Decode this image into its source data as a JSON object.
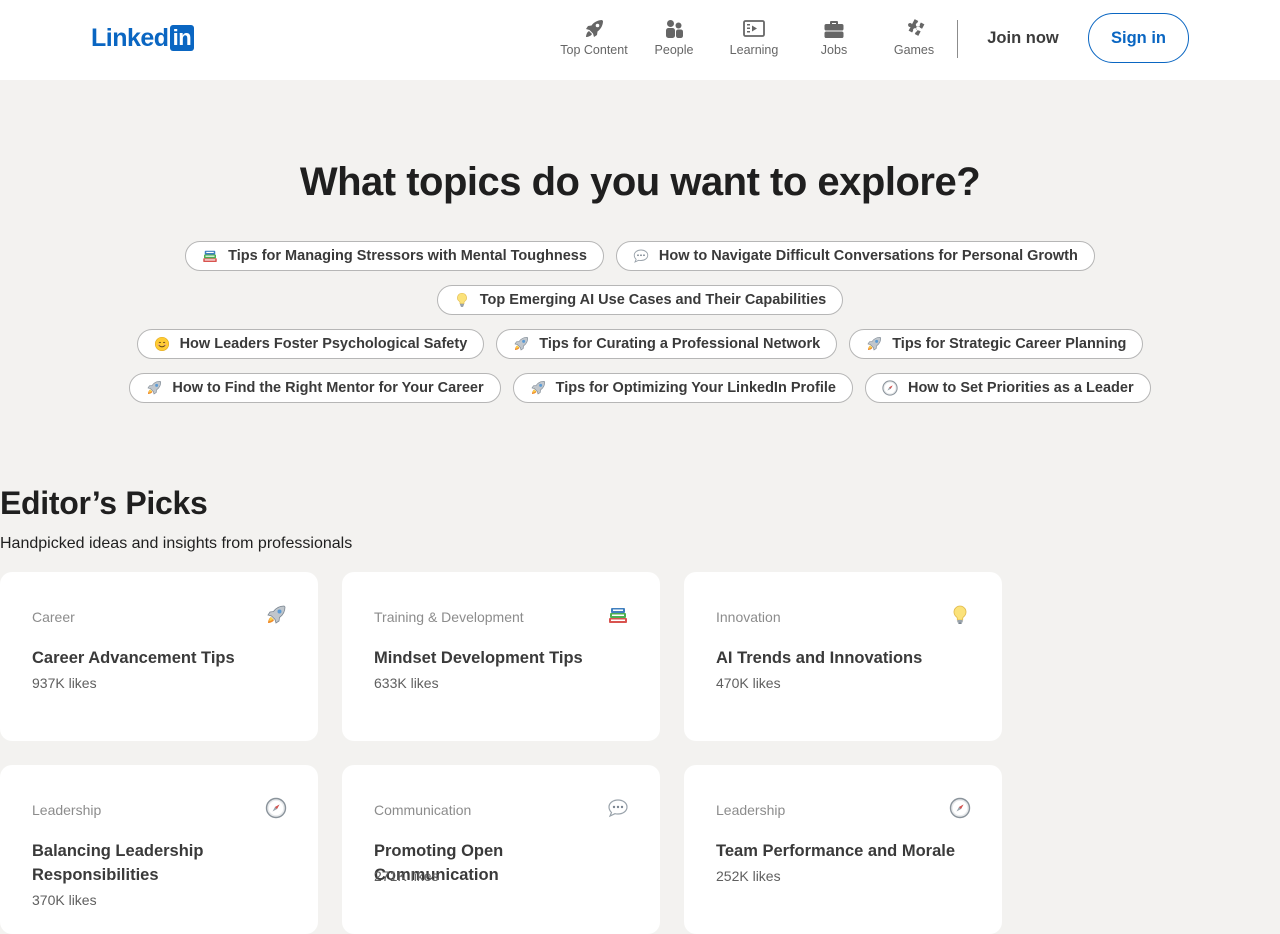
{
  "brand": {
    "logo_text": "Linked",
    "logo_box": "in",
    "accent": "#0a66c2"
  },
  "nav": {
    "items": [
      {
        "label": "Top Content",
        "icon": "rocket-icon"
      },
      {
        "label": "People",
        "icon": "people-icon"
      },
      {
        "label": "Learning",
        "icon": "learning-icon"
      },
      {
        "label": "Jobs",
        "icon": "briefcase-icon"
      },
      {
        "label": "Games",
        "icon": "puzzle-icon"
      }
    ],
    "join_label": "Join now",
    "signin_label": "Sign in"
  },
  "hero": {
    "title": "What topics do you want to explore?",
    "pills": [
      {
        "label": "Tips for Managing Stressors with Mental Toughness",
        "icon": "books-icon"
      },
      {
        "label": "How to Navigate Difficult Conversations for Personal Growth",
        "icon": "speech-bubble-icon"
      },
      {
        "label": "Top Emerging AI Use Cases and Their Capabilities",
        "icon": "lightbulb-icon"
      },
      {
        "label": "How Leaders Foster Psychological Safety",
        "icon": "smiley-icon"
      },
      {
        "label": "Tips for Curating a Professional Network",
        "icon": "rocket-icon"
      },
      {
        "label": "Tips for Strategic Career Planning",
        "icon": "rocket-icon"
      },
      {
        "label": "How to Find the Right Mentor for Your Career",
        "icon": "rocket-icon"
      },
      {
        "label": "Tips for Optimizing Your LinkedIn Profile",
        "icon": "rocket-icon"
      },
      {
        "label": "How to Set Priorities as a Leader",
        "icon": "compass-icon"
      }
    ]
  },
  "editors_picks": {
    "title": "Editor’s Picks",
    "subtitle": "Handpicked ideas and insights from professionals",
    "cards": [
      {
        "category": "Career",
        "title": "Career Advancement Tips",
        "likes": "937K likes",
        "icon": "rocket-icon"
      },
      {
        "category": "Training & Development",
        "title": "Mindset Development Tips",
        "likes": "633K likes",
        "icon": "books-icon"
      },
      {
        "category": "Innovation",
        "title": "AI Trends and Innovations",
        "likes": "470K likes",
        "icon": "lightbulb-icon"
      },
      {
        "category": "Leadership",
        "title": "Balancing Leadership Responsibilities",
        "likes": "370K likes",
        "icon": "compass-icon"
      },
      {
        "category": "Communication",
        "title": "Promoting Open Communication",
        "likes": "271K likes",
        "icon": "speech-bubble-icon"
      },
      {
        "category": "Leadership",
        "title": "Team Performance and Morale",
        "likes": "252K likes",
        "icon": "compass-icon"
      }
    ]
  }
}
